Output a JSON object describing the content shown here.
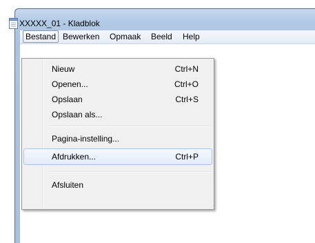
{
  "window": {
    "title": "XXXXX_01 - Kladblok"
  },
  "menubar": {
    "items": [
      {
        "label": "Bestand"
      },
      {
        "label": "Bewerken"
      },
      {
        "label": "Opmaak"
      },
      {
        "label": "Beeld"
      },
      {
        "label": "Help"
      }
    ]
  },
  "file_menu": {
    "items": [
      {
        "label": "Nieuw",
        "shortcut": "Ctrl+N"
      },
      {
        "label": "Openen...",
        "shortcut": "Ctrl+O"
      },
      {
        "label": "Opslaan",
        "shortcut": "Ctrl+S"
      },
      {
        "label": "Opslaan als...",
        "shortcut": ""
      },
      {
        "label": "Pagina-instelling...",
        "shortcut": ""
      },
      {
        "label": "Afdrukken...",
        "shortcut": "Ctrl+P"
      },
      {
        "label": "Afsluiten",
        "shortcut": ""
      }
    ]
  },
  "colors": {
    "frame": "#aac4e2",
    "menu_bg": "#f0f0f0",
    "hover_border": "#a8c4e8"
  }
}
